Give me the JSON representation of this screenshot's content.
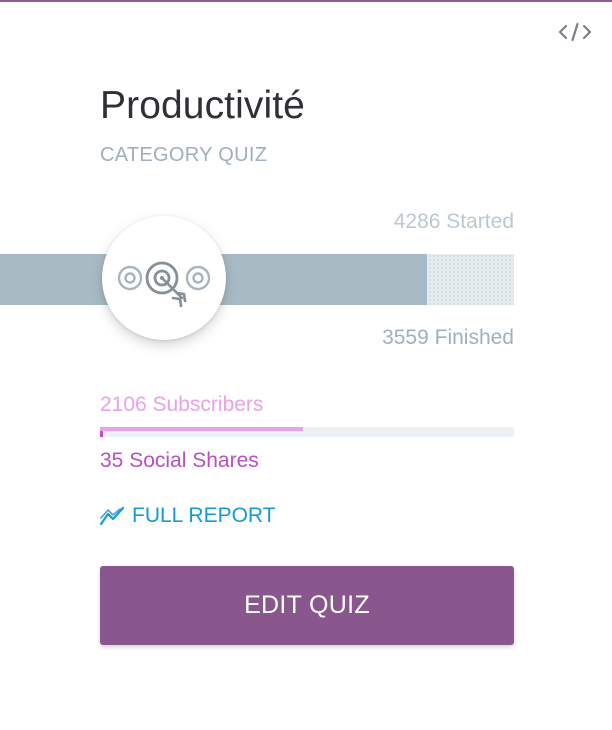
{
  "card": {
    "title": "Productivité",
    "subtitle": "CATEGORY QUIZ",
    "embed_icon": "code-embed-icon"
  },
  "funnel": {
    "started_label": "4286 Started",
    "finished_label": "3559 Finished",
    "started": 4286,
    "finished": 3559,
    "icon": "target-icon"
  },
  "engagement": {
    "subscribers_label": "2106 Subscribers",
    "subscribers": 2106,
    "shares_label": "35 Social Shares",
    "shares": 35
  },
  "report": {
    "label": "FULL REPORT",
    "icon": "trend-chart-icon"
  },
  "actions": {
    "edit_label": "EDIT QUIZ"
  },
  "colors": {
    "accent": "#89568d",
    "link": "#159ad6",
    "subscribers": "#e7a2ea",
    "shares": "#b94ec0",
    "funnel_fill": "#a8bac4",
    "funnel_track": "#e4ebef",
    "muted": "#9fb0bc"
  }
}
